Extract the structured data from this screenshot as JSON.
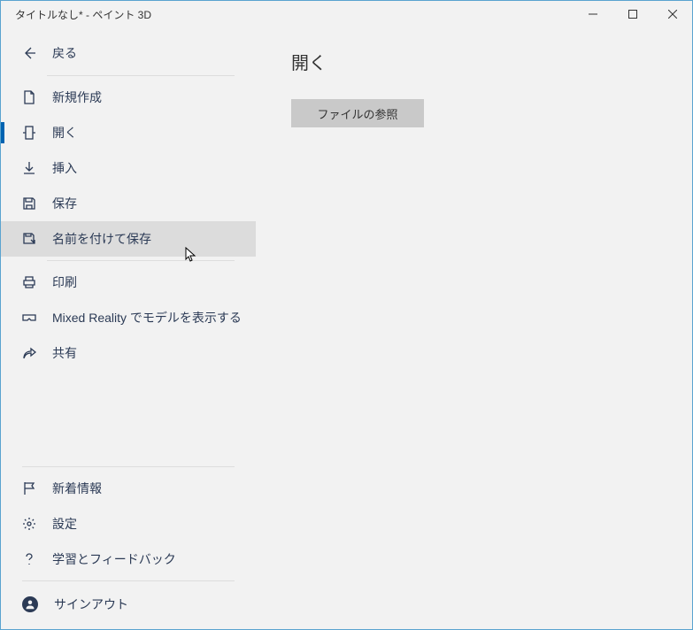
{
  "window": {
    "title": "タイトルなし* - ペイント 3D"
  },
  "back": {
    "label": "戻る"
  },
  "menu": {
    "new": "新規作成",
    "open": "開く",
    "insert": "挿入",
    "save": "保存",
    "saveas": "名前を付けて保存",
    "print": "印刷",
    "mr": "Mixed Reality でモデルを表示する",
    "share": "共有"
  },
  "footer": {
    "news": "新着情報",
    "settings": "設定",
    "feedback": "学習とフィードバック",
    "signout": "サインアウト"
  },
  "main": {
    "heading": "開く",
    "browse": "ファイルの参照"
  }
}
